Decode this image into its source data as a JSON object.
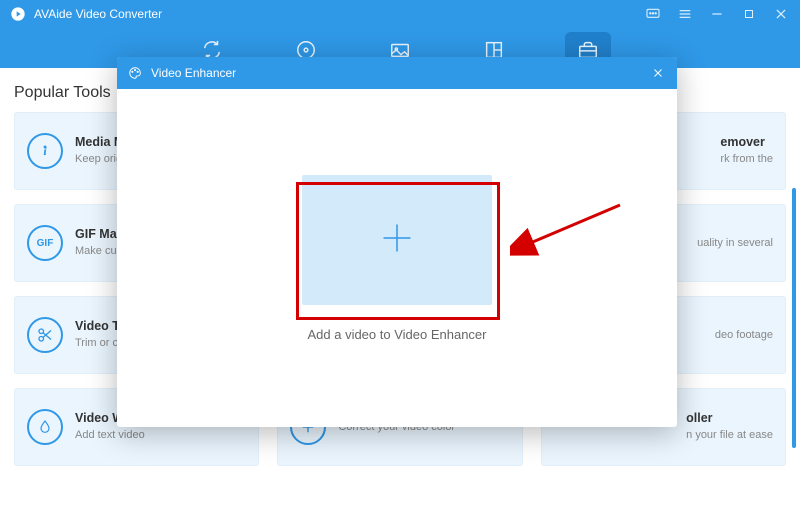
{
  "titlebar": {
    "app_name": "AVAide Video Converter"
  },
  "section_title": "Popular Tools",
  "tools": [
    {
      "title": "Media M",
      "desc": "Keep origi\nwant",
      "icon": "info"
    },
    {
      "title": "",
      "desc": "",
      "icon": "blank"
    },
    {
      "title": "emover",
      "desc": "rk from the",
      "icon": "blank"
    },
    {
      "title": "GIF Mak",
      "desc": "Make cus\nor image",
      "icon": "gif"
    },
    {
      "title": "",
      "desc": "",
      "icon": "blank"
    },
    {
      "title": "",
      "desc": "uality in several",
      "icon": "blank"
    },
    {
      "title": "Video Tr",
      "desc": "Trim or c\nlength",
      "icon": "scissors"
    },
    {
      "title": "",
      "desc": "",
      "icon": "blank"
    },
    {
      "title": "",
      "desc": "deo footage",
      "icon": "blank"
    },
    {
      "title": "Video W",
      "desc": "Add text\nvideo",
      "icon": "drop"
    },
    {
      "title": "",
      "desc": "Correct your video color",
      "icon": "color"
    },
    {
      "title": "oller",
      "desc": "n your file at\nease",
      "icon": "blank"
    }
  ],
  "modal": {
    "title": "Video Enhancer",
    "hint": "Add a video to Video Enhancer"
  }
}
